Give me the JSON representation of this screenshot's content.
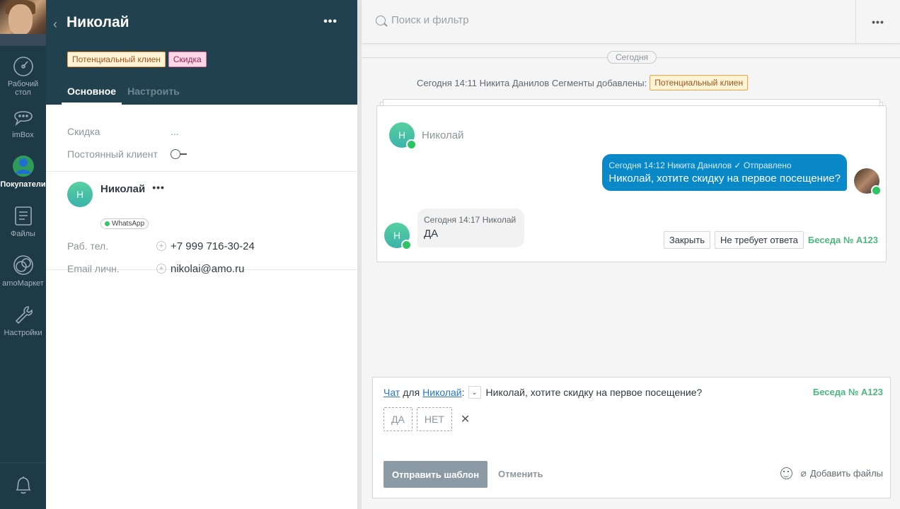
{
  "nav": {
    "items": [
      {
        "label": "Рабочий стол",
        "icon": "dashboard-icon"
      },
      {
        "label": "imBox",
        "icon": "chat-icon"
      },
      {
        "label": "Покупатели",
        "icon": "customers-icon"
      },
      {
        "label": "Файлы",
        "icon": "files-icon"
      },
      {
        "label": "amoМаркет",
        "icon": "market-icon"
      },
      {
        "label": "Настройки",
        "icon": "settings-icon"
      }
    ],
    "bell_icon": "bell-icon"
  },
  "card": {
    "back": "‹",
    "title": "Николай",
    "more": "•••",
    "tags": [
      "Потенциальный клиен",
      "Скидка"
    ],
    "tabs": [
      "Основное",
      "Настроить"
    ],
    "fields": [
      {
        "label": "Скидка",
        "value": "..."
      },
      {
        "label": "Постоянный клиент",
        "value": ""
      }
    ],
    "contact": {
      "initial": "Н",
      "name": "Николай",
      "more": "•••",
      "channel": "WhatsApp",
      "rows": [
        {
          "label": "Раб. тел.",
          "value": "+7 999 716-30-24"
        },
        {
          "label": "Email личн.",
          "value": "nikolai@amo.ru"
        }
      ]
    }
  },
  "feed": {
    "search_placeholder": "Поиск и фильтр",
    "search_more": "•••",
    "day": "Сегодня",
    "sys_note": "Сегодня 14:11 Никита Данилов Сегменты добавлены:",
    "sys_tag": "Потенциальный клиен",
    "chat": {
      "head_initial": "Н",
      "head_name": "Николай",
      "out_meta": "Сегодня 14:12 Никита Данилов ✓ Отправлено",
      "out_text": "Николай, хотите скидку на первое посещение?",
      "in_meta": "Сегодня 14:17 Николай",
      "in_text": "ДА",
      "in_initial": "Н",
      "btn_close": "Закрыть",
      "btn_no_reply": "Не требует ответа",
      "talk": "Беседа № A123"
    },
    "composer": {
      "chat_link": "Чат",
      "for": "для",
      "recipient": "Николай",
      "colon": ":",
      "dd": "⌄",
      "template_text": "Николай, хотите скидку на первое посещение?",
      "talk": "Беседа № A123",
      "quick_replies": [
        "ДА",
        "НЕТ"
      ],
      "remove": "✕",
      "send": "Отправить шаблон",
      "cancel": "Отменить",
      "attach": "Добавить файлы"
    }
  }
}
